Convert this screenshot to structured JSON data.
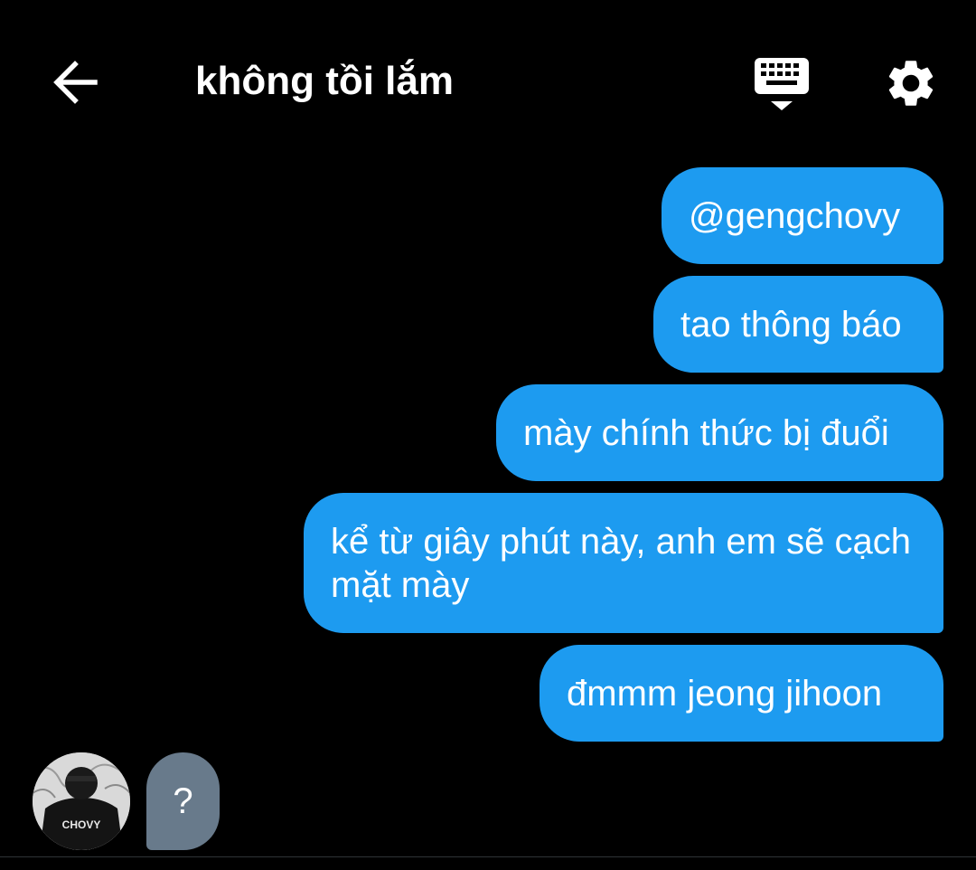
{
  "header": {
    "title": "không tồi lắm",
    "back_icon": "arrow-left-icon",
    "keyboard_icon": "keyboard-icon",
    "settings_icon": "gear-icon"
  },
  "messages": {
    "sent": [
      "@gengchovy",
      "tao thông báo",
      "mày chính thức bị đuổi",
      "kể từ giây phút này, anh em sẽ cạch mặt mày",
      "đmmm jeong jihoon"
    ],
    "received": [
      "?"
    ]
  },
  "avatar": {
    "shirt_text": "CHOVY"
  },
  "colors": {
    "background": "#000000",
    "sent_bubble": "#1d9bf0",
    "received_bubble": "#687a8b",
    "text": "#ffffff"
  }
}
